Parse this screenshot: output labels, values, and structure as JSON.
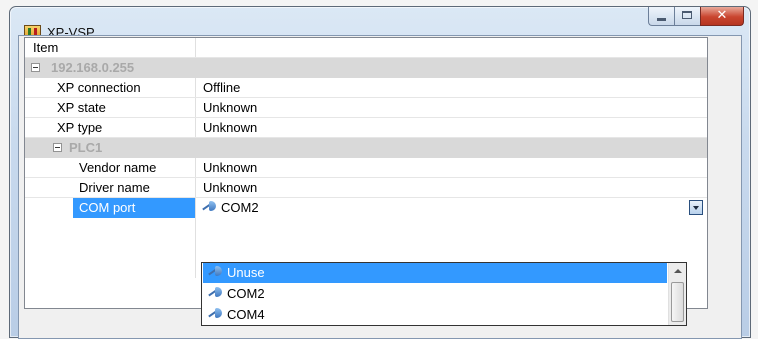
{
  "window": {
    "title": "XP-VSP"
  },
  "grid": {
    "header": {
      "item": "Item",
      "value": ""
    },
    "group_ip": "192.168.0.255",
    "rows": [
      {
        "key": "XP connection",
        "value": "Offline"
      },
      {
        "key": "XP state",
        "value": "Unknown"
      },
      {
        "key": "XP type",
        "value": "Unknown"
      }
    ],
    "group_plc": "PLC1",
    "plc_rows": [
      {
        "key": "Vendor name",
        "value": "Unknown"
      },
      {
        "key": "Driver name",
        "value": "Unknown"
      }
    ],
    "com_port": {
      "key": "COM port",
      "value": "COM2"
    }
  },
  "dropdown": {
    "options": [
      "Unuse",
      "COM2",
      "COM4"
    ],
    "selected": "Unuse"
  },
  "colors": {
    "selection": "#3399ff",
    "group_bg": "#d9d9d9"
  },
  "icons": [
    "app-icon",
    "minimize-icon",
    "maximize-icon",
    "close-icon",
    "expand-icon",
    "plug-icon",
    "dropdown-arrow-icon",
    "scroll-up-icon"
  ]
}
